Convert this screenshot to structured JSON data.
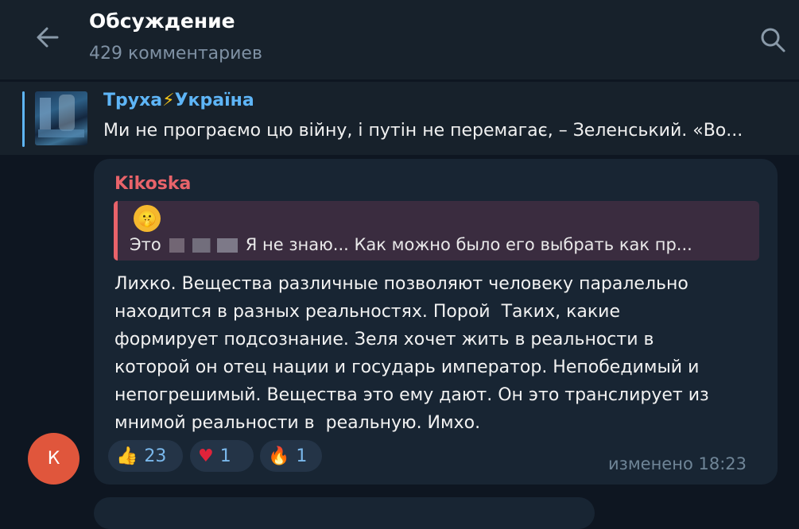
{
  "header": {
    "title": "Обсуждение",
    "subtitle": "429 комментариев"
  },
  "pinned": {
    "channel_name_part1": "Труха",
    "channel_name_part2": "Україна",
    "text": "Ми не програємо цю війну, і путін не перемагає, – Зеленський.  «Во..."
  },
  "comment": {
    "author": "Kikoska",
    "avatar_letter": "К",
    "reply_text_before": "Это",
    "reply_text_after": "Я не знаю... Как можно было его выбрать как пр...",
    "body": "Лихко. Вещества различные позволяют человеку паралельно\nнаходится в разных реальностях. Порой  Таких, какие\nформирует подсознание. Зеля хочет жить в реальности в\nкоторой он отец нации и государь император. Непобедимый и\nнепогрешимый. Вещества это ему дают. Он это транслирует из\nмнимой реальности в  реальную. Имхо.",
    "reactions": [
      {
        "emoji": "👍",
        "count": "23"
      },
      {
        "emoji": "♥",
        "count": "1"
      },
      {
        "emoji": "🔥",
        "count": "1"
      }
    ],
    "edited_label": "изменено 18:23"
  },
  "colors": {
    "background": "#0e1621",
    "header": "#17212b",
    "bubble": "#182533",
    "accent": "#5eb5f7",
    "author": "#e8636a",
    "avatar": "#e0563c"
  }
}
